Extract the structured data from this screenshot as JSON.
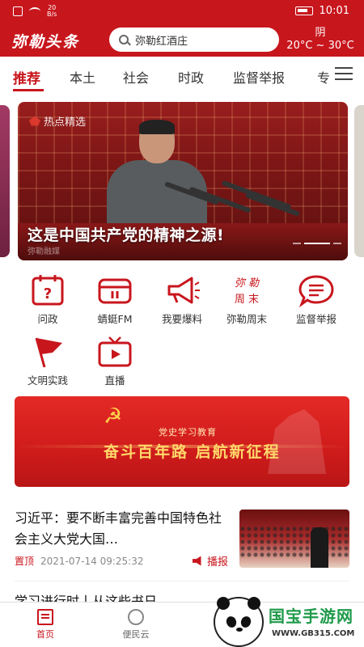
{
  "status_bar": {
    "speed_value": "20",
    "speed_unit": "B/s",
    "time": "10:01"
  },
  "header": {
    "logo": "弥勒头条",
    "search_placeholder": "弥勒红酒庄",
    "weather_condition": "阴",
    "weather_temp": "20°C ~ 30°C"
  },
  "tabs": [
    "推荐",
    "本土",
    "社会",
    "时政",
    "监督举报",
    "专"
  ],
  "carousel": {
    "tag": "热点精选",
    "caption": "这是中国共产党的精神之源!",
    "watermark": "弥勒融媒"
  },
  "features": [
    {
      "label": "问政",
      "icon": "calendar-question-icon"
    },
    {
      "label": "蜻蜓FM",
      "icon": "radio-icon"
    },
    {
      "label": "我要爆料",
      "icon": "megaphone-icon"
    },
    {
      "label": "弥勒周末",
      "icon": "weekend-logo-icon"
    },
    {
      "label": "监督举报",
      "icon": "chat-bubble-icon"
    },
    {
      "label": "文明实践",
      "icon": "flag-icon"
    },
    {
      "label": "直播",
      "icon": "tv-play-icon"
    }
  ],
  "banner": {
    "subtitle": "党史学习教育",
    "title": "奋斗百年路 启航新征程"
  },
  "news": [
    {
      "title": "习近平：要不断丰富完善中国特色社会主义大党大国…",
      "pinned": "置顶",
      "date": "2021-07-14 09:25:32",
      "play": "播报"
    }
  ],
  "next_news_title": "学习进行时丨从这些书日…",
  "bottom_nav": [
    {
      "label": "首页",
      "active": true
    },
    {
      "label": "便民云",
      "active": false
    }
  ],
  "promo": {
    "title": "国宝手游网",
    "url": "WWW.GB315.COM"
  },
  "colors": {
    "brand_red": "#c8161d",
    "promo_green": "#1f9a4a"
  }
}
